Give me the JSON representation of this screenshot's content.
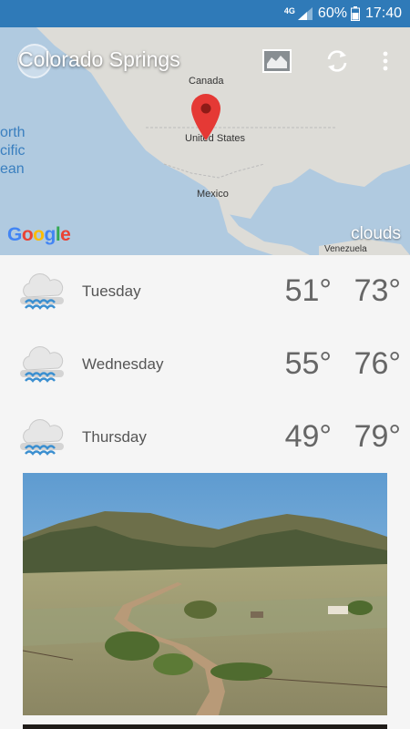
{
  "status_bar": {
    "network": "4G",
    "battery": "60%",
    "time": "17:40"
  },
  "header": {
    "location": "Colorado Springs"
  },
  "map": {
    "labels": {
      "canada": "Canada",
      "usa": "United States",
      "mexico": "Mexico",
      "venezuela": "Venezuela"
    },
    "ocean_lines": [
      "orth",
      "cific",
      "ean"
    ],
    "attribution": "Google",
    "layer": "clouds"
  },
  "forecast": [
    {
      "day": "Tuesday",
      "low": "51°",
      "high": "73°",
      "icon": "rain-cloud-icon"
    },
    {
      "day": "Wednesday",
      "low": "55°",
      "high": "76°",
      "icon": "rain-cloud-icon"
    },
    {
      "day": "Thursday",
      "low": "49°",
      "high": "79°",
      "icon": "rain-cloud-icon"
    }
  ],
  "colors": {
    "status_bar": "#2f7ab8",
    "map_land": "#e5e3dd",
    "map_water": "#a9cbe8",
    "pin": "#e53935",
    "rain": "#3b8fd0"
  }
}
